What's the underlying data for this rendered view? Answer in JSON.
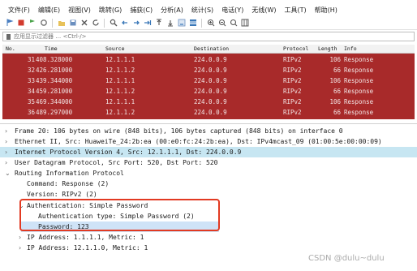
{
  "menu": [
    "文件(F)",
    "编辑(E)",
    "视图(V)",
    "跳转(G)",
    "捕获(C)",
    "分析(A)",
    "统计(S)",
    "电话(Y)",
    "无线(W)",
    "工具(T)",
    "帮助(H)"
  ],
  "toolbar_icons": [
    "fin-icon",
    "stop-icon",
    "restart-icon",
    "options-icon",
    "open-icon",
    "save-icon",
    "close-file-icon",
    "reload-icon",
    "find-icon",
    "back-icon",
    "forward-icon",
    "goto-icon",
    "first-icon",
    "last-icon",
    "autoscroll-icon",
    "colorize-icon",
    "zoom-in-icon",
    "zoom-out-icon",
    "zoom-reset-icon",
    "resize-columns-icon"
  ],
  "filter": {
    "placeholder": "应用显示过滤器 … <Ctrl-/>"
  },
  "packet_list": {
    "columns": [
      "No.",
      "Time",
      "Source",
      "Destination",
      "Protocol",
      "Length",
      "Info"
    ],
    "rows": [
      {
        "no": "31",
        "time": "408.328000",
        "source": "12.1.1.1",
        "destination": "224.0.0.9",
        "protocol": "RIPv2",
        "length": "106",
        "info": "Response"
      },
      {
        "no": "32",
        "time": "426.281000",
        "source": "12.1.1.2",
        "destination": "224.0.0.9",
        "protocol": "RIPv2",
        "length": "66",
        "info": "Response"
      },
      {
        "no": "33",
        "time": "439.344000",
        "source": "12.1.1.1",
        "destination": "224.0.0.9",
        "protocol": "RIPv2",
        "length": "106",
        "info": "Response"
      },
      {
        "no": "34",
        "time": "459.281000",
        "source": "12.1.1.2",
        "destination": "224.0.0.9",
        "protocol": "RIPv2",
        "length": "66",
        "info": "Response"
      },
      {
        "no": "35",
        "time": "469.344000",
        "source": "12.1.1.1",
        "destination": "224.0.0.9",
        "protocol": "RIPv2",
        "length": "106",
        "info": "Response"
      },
      {
        "no": "36",
        "time": "489.297000",
        "source": "12.1.1.2",
        "destination": "224.0.0.9",
        "protocol": "RIPv2",
        "length": "66",
        "info": "Response"
      }
    ],
    "row_color": "#a82a2a"
  },
  "details": [
    {
      "arrow": "›",
      "text": "Frame 20: 106 bytes on wire (848 bits), 106 bytes captured (848 bits) on interface 0"
    },
    {
      "arrow": "›",
      "text": "Ethernet II, Src: HuaweiTe_24:2b:ea (00:e0:fc:24:2b:ea), Dst: IPv4mcast_09 (01:00:5e:00:00:09)"
    },
    {
      "arrow": "›",
      "text": "Internet Protocol Version 4, Src: 12.1.1.1, Dst: 224.0.0.9"
    },
    {
      "arrow": "›",
      "text": "User Datagram Protocol, Src Port: 520, Dst Port: 520"
    },
    {
      "arrow": "⌄",
      "text": "Routing Information Protocol"
    },
    {
      "arrow": "",
      "text": "Command: Response (2)"
    },
    {
      "arrow": "",
      "text": "Version: RIPv2 (2)"
    },
    {
      "arrow": "⌄",
      "text": "Authentication: Simple Password"
    },
    {
      "arrow": "",
      "text": "Authentication type: Simple Password (2)"
    },
    {
      "arrow": "",
      "text": "Password: 123"
    },
    {
      "arrow": "›",
      "text": "IP Address: 1.1.1.1, Metric: 1"
    },
    {
      "arrow": "›",
      "text": "IP Address: 12.1.1.0, Metric: 1"
    }
  ],
  "watermark": "CSDN @dulu~dulu"
}
